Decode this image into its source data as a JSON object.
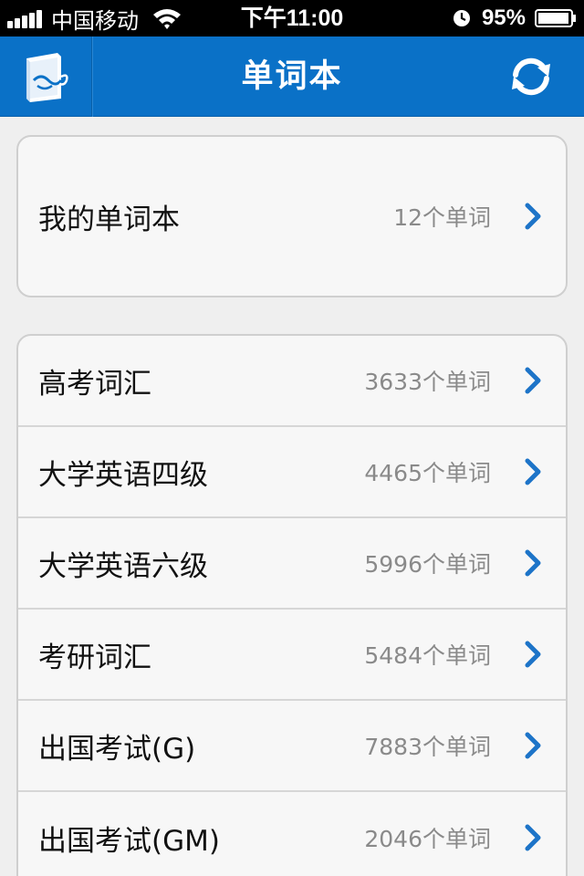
{
  "status_bar": {
    "carrier": "中国移动",
    "time": "下午11:00",
    "battery": "95%"
  },
  "nav": {
    "title": "单词本",
    "logo_icon": "book-logo-icon",
    "refresh_icon": "refresh-icon"
  },
  "my_wordbook": {
    "label": "我的单词本",
    "count": "12个单词"
  },
  "wordbooks": [
    {
      "label": "高考词汇",
      "count": "3633个单词"
    },
    {
      "label": "大学英语四级",
      "count": "4465个单词"
    },
    {
      "label": "大学英语六级",
      "count": "5996个单词"
    },
    {
      "label": "考研词汇",
      "count": "5484个单词"
    },
    {
      "label": "出国考试(G)",
      "count": "7883个单词"
    },
    {
      "label": "出国考试(GM)",
      "count": "2046个单词"
    }
  ],
  "colors": {
    "nav_blue": "#0a71c7",
    "chevron_blue": "#1d74c8"
  }
}
